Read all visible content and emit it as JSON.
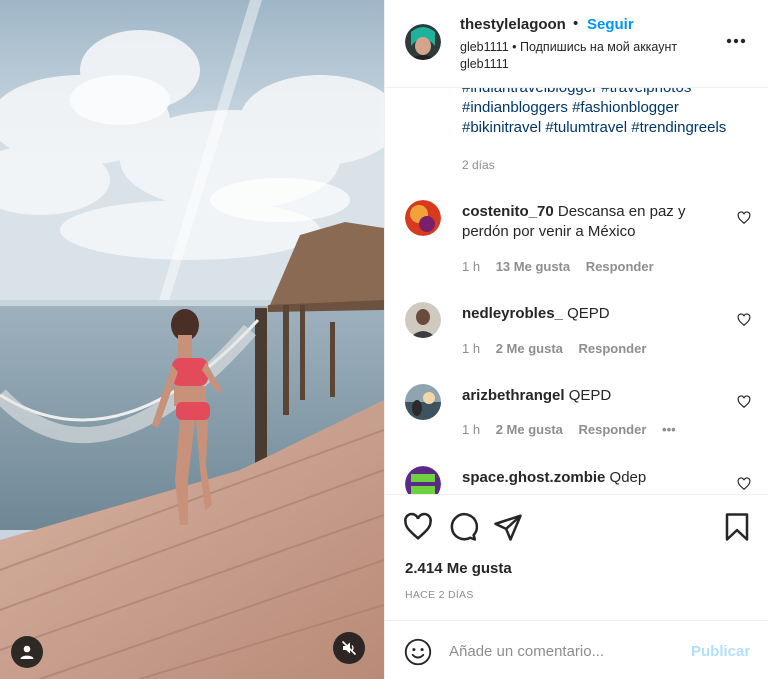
{
  "post": {
    "author": "thestylelagoon",
    "separator": "•",
    "follow_label": "Seguir",
    "subtitle": "gleb1111 • Подпишись на мой аккаунт gleb1111",
    "more_icon": "more-horizontal-icon"
  },
  "caption": {
    "hashtags": [
      "#indiantravelblogger #travelphotos",
      "#indianbloggers #fashionblogger",
      "#bikinitravel #tulumtravel #trendingreels"
    ],
    "time": "2 días"
  },
  "comments": [
    {
      "user": "costenito_70",
      "text": "Descansa en paz y perdón por venir a México",
      "time": "1 h",
      "likes": "13 Me gusta",
      "reply": "Responder",
      "options": ""
    },
    {
      "user": "nedleyrobles_",
      "text": "QEPD",
      "time": "1 h",
      "likes": "2 Me gusta",
      "reply": "Responder",
      "options": ""
    },
    {
      "user": "arizbethrangel",
      "text": "QEPD",
      "time": "1 h",
      "likes": "2 Me gusta",
      "reply": "Responder",
      "options": "•••"
    },
    {
      "user": "space.ghost.zombie",
      "text": "Qdep",
      "time": "",
      "likes": "",
      "reply": "",
      "options": ""
    }
  ],
  "actions": {
    "like_icon": "heart-icon",
    "comment_icon": "comment-icon",
    "share_icon": "paper-plane-icon",
    "save_icon": "bookmark-icon",
    "likes_count": "2.414 Me gusta",
    "posted": "HACE 2 DÍAS"
  },
  "add_comment": {
    "placeholder": "Añade un comentario...",
    "publish_label": "Publicar"
  },
  "colors": {
    "link_blue": "#0095f6",
    "hashtag": "#00376b",
    "muted": "#8e8e8e",
    "publish_disabled": "#b2dffc"
  }
}
